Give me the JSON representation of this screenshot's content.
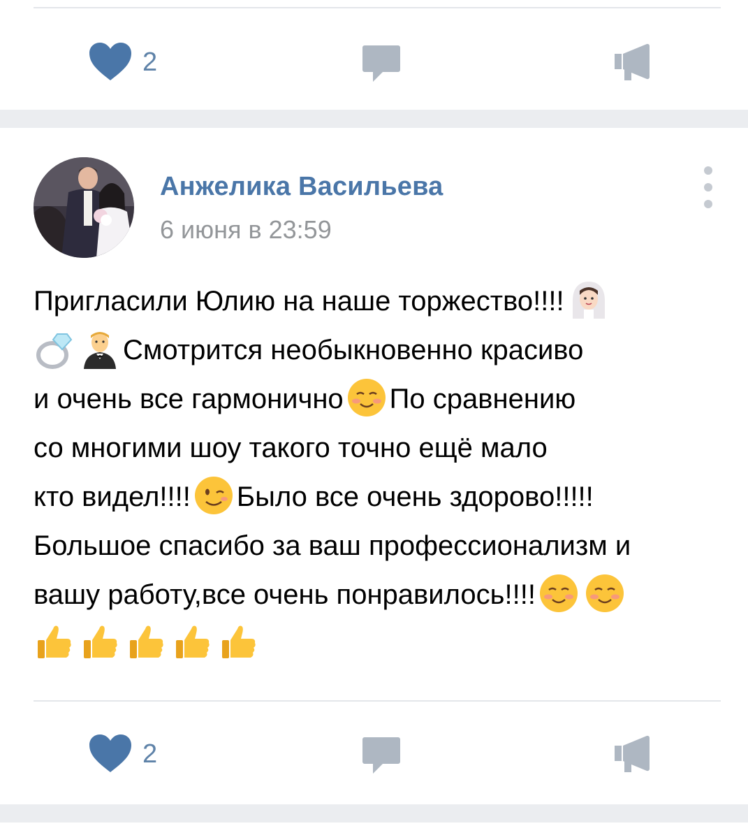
{
  "top_post": {
    "likes": "2"
  },
  "post": {
    "author": "Анжелика Васильева",
    "date": "6 июня в 23:59",
    "text_lines": [
      "Пригласили Юлию на наше торжество!!!!",
      "Смотрится необыкновенно красиво",
      "и очень все гармонично",
      "По сравнению",
      "со многими шоу такого точно ещё мало",
      "кто видел!!!!",
      "Было все очень здорово!!!!!",
      "Большое спасибо за ваш профессионализм и",
      "вашу работу,все очень понравилось!!!!"
    ],
    "likes": "2"
  },
  "icons": {
    "like": "heart-icon",
    "comment": "comment-icon",
    "share": "megaphone-icon",
    "more": "more-vertical-icon",
    "emoji": [
      "bride-emoji",
      "ring-emoji",
      "groom-emoji",
      "smiling-emoji",
      "wink-emoji",
      "thumbs-up-emoji"
    ]
  },
  "colors": {
    "accent": "#4a76a8",
    "like": "#4a76a8",
    "icon_gray": "#aeb7c2",
    "date": "#939699",
    "separator": "#ebedf0"
  }
}
